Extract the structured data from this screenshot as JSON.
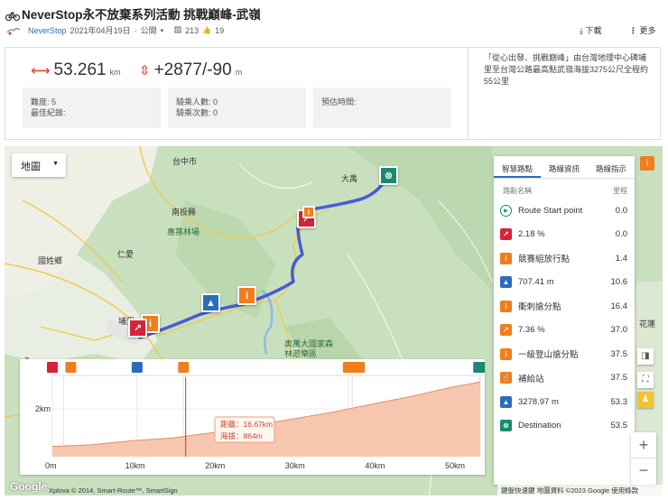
{
  "header": {
    "title": "NeverStop永不放棄系列活動 挑戰巔峰-武嶺",
    "owner": "NeverStop",
    "date": "2021年04月19日",
    "visibility": "公開",
    "views": "213",
    "likes": "19",
    "download_label": "下載",
    "more_label": "更多"
  },
  "stats": {
    "distance": "53.261",
    "distance_unit": "km",
    "elevation": "+2877/-90",
    "elevation_unit": "m",
    "difficulty": "難度: 5",
    "record": "最佳紀錄:",
    "riders": "騎乘人數: 0",
    "rides": "騎乘次數: 0",
    "estimated": "預估時間:"
  },
  "description": "「從心出發、挑戰巔峰」由台灣地理中心碑埔里至台灣公路最高點武嶺海拔3275公尺全程約55公里",
  "map": {
    "type_label": "地圖",
    "labels": {
      "taichung": "台中市",
      "nantou": "南投縣",
      "huisun": "惠蓀林場",
      "renai": "仁愛",
      "guoxing": "國姓鄉",
      "puli": "埔里",
      "aowanda": "奧萬大國家森林遊樂區",
      "hualien": "花蓮",
      "datong": "大禹",
      "hualien_county": "花蓮縣",
      "hualien2": "花蓮縣"
    },
    "attribution_left": "Xplova © 2014, Smart-Route™, SmartSign",
    "attribution_right": "鍵盤快速鍵  地圖資料 ©2023 Google  使用條款",
    "google": "Google"
  },
  "panel": {
    "tabs": [
      "智慧路點",
      "路線資訊",
      "路線指示"
    ],
    "col_name": "路點名稱",
    "col_dist": "里程",
    "waypoints": [
      {
        "name": "Route Start point",
        "dist": "0.0",
        "icon": "start-icon",
        "color": "#1a8a6e"
      },
      {
        "name": "2.18 %",
        "dist": "0.0",
        "icon": "climb-icon",
        "color": "#d6233a"
      },
      {
        "name": "競賽組放行點",
        "dist": "1.4",
        "icon": "info-icon",
        "color": "#f07e1c"
      },
      {
        "name": "707.41 m",
        "dist": "10.6",
        "icon": "summit-icon",
        "color": "#2a6ebb"
      },
      {
        "name": "衝刺搶分點",
        "dist": "16.4",
        "icon": "info-icon",
        "color": "#f07e1c"
      },
      {
        "name": "7.36 %",
        "dist": "37.0",
        "icon": "climb-icon",
        "color": "#f07e1c"
      },
      {
        "name": "一級登山搶分點",
        "dist": "37.5",
        "icon": "info-icon",
        "color": "#f07e1c"
      },
      {
        "name": "補給站",
        "dist": "37.5",
        "icon": "food-icon",
        "color": "#f07e1c"
      },
      {
        "name": "3278.97 m",
        "dist": "53.3",
        "icon": "summit-icon",
        "color": "#2a6ebb"
      },
      {
        "name": "Destination",
        "dist": "53.5",
        "icon": "finish-icon",
        "color": "#1a8a6e"
      }
    ]
  },
  "elevation": {
    "y_tick": "2km",
    "x_ticks": [
      "0m",
      "10km",
      "20km",
      "30km",
      "40km",
      "50km"
    ],
    "tooltip_distance": "距離：16.67km",
    "tooltip_altitude": "海拔：864m"
  },
  "chart_data": {
    "type": "area",
    "title": "",
    "xlabel": "",
    "ylabel": "",
    "x": [
      0,
      5,
      10,
      15,
      20,
      25,
      30,
      35,
      40,
      45,
      50,
      53.5
    ],
    "values": [
      450,
      520,
      700,
      820,
      1050,
      1350,
      1650,
      1950,
      2300,
      2650,
      3050,
      3275
    ],
    "xlim": [
      0,
      53.5
    ],
    "ylim": [
      0,
      3400
    ],
    "color": "#f3b79c"
  },
  "colors": {
    "route": "#4a5bd6",
    "accent": "#f07e1c",
    "link": "#2a6ebb"
  }
}
